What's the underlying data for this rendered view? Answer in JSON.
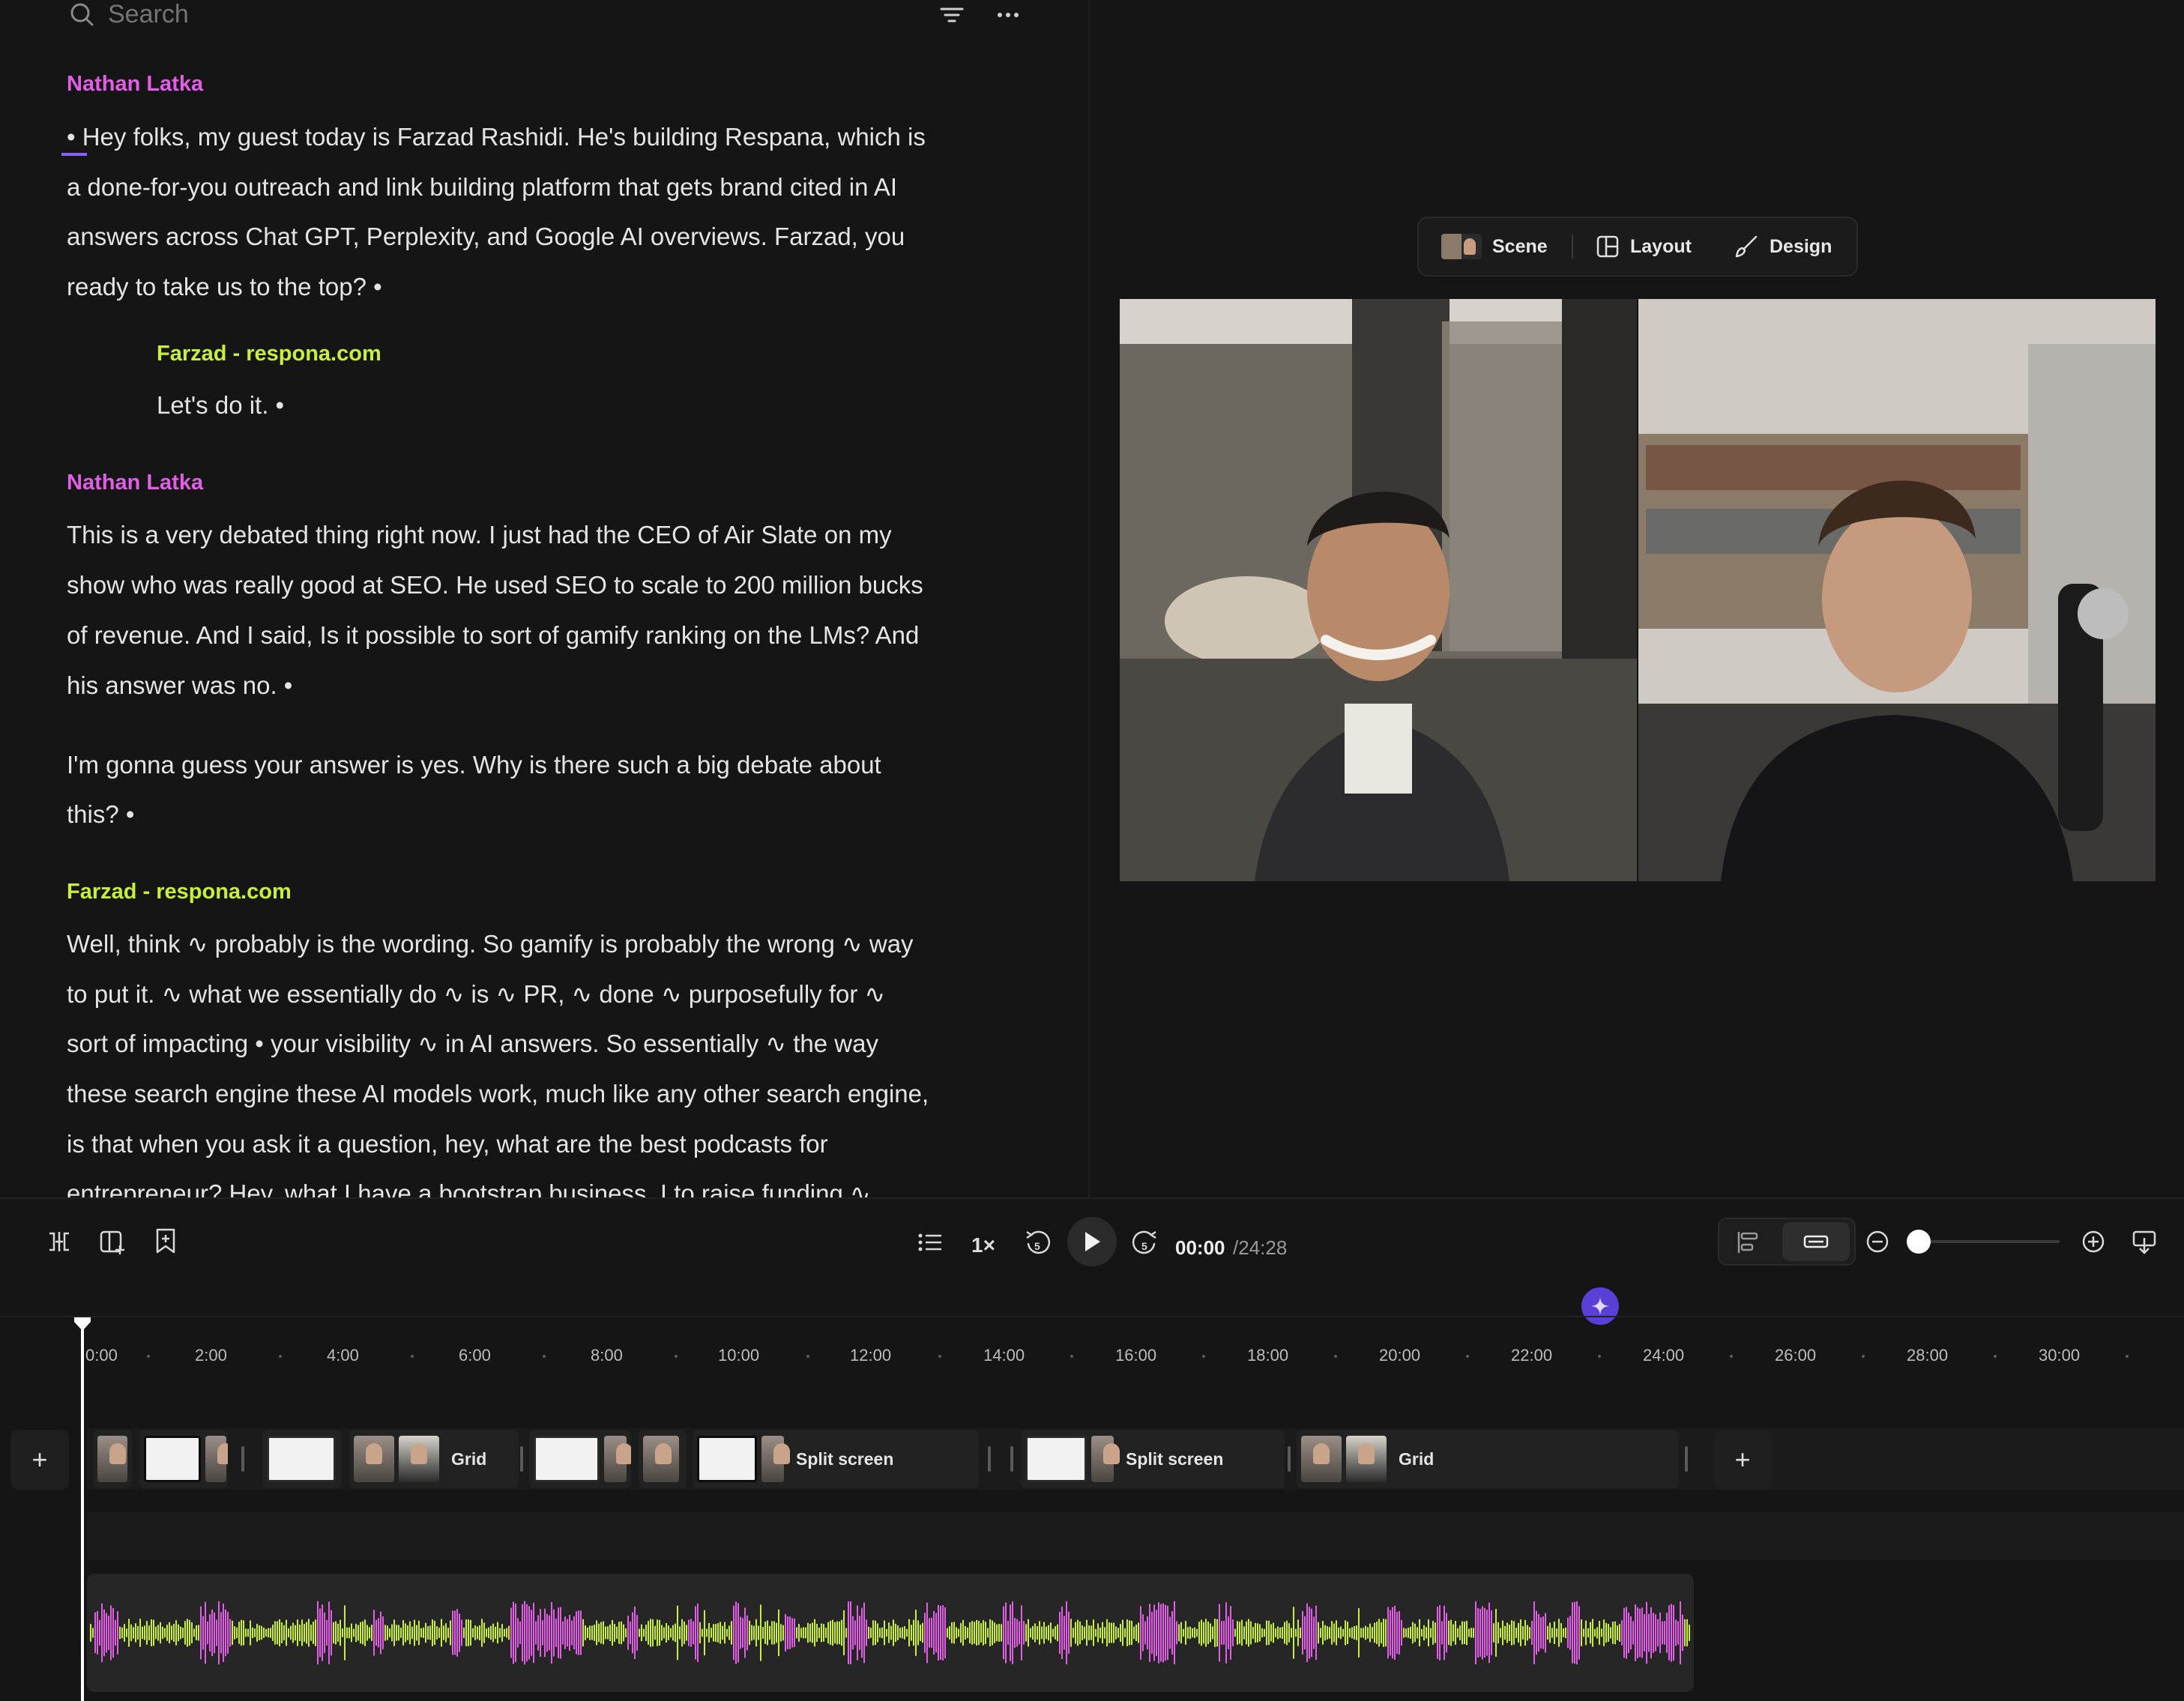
{
  "search": {
    "placeholder": "Search"
  },
  "transcript": {
    "speakers": {
      "nathan": "Nathan Latka",
      "farzad": "Farzad - respona.com"
    },
    "blocks": [
      {
        "speaker": "Nathan Latka",
        "lines": [
          "• Hey folks, my guest today is Farzad Rashidi. He's building Respana, which is",
          "a done-for-you outreach and link building platform that gets brand cited in AI",
          "answers across Chat GPT, Perplexity, and Google AI overviews. Farzad, you",
          "ready to take us to the top? •"
        ]
      },
      {
        "speaker": "Farzad - respona.com",
        "lines": [
          "Let's do it. •"
        ]
      },
      {
        "speaker": "Nathan Latka",
        "lines": [
          "This is a very debated thing right now. I just had the CEO of Air Slate on my",
          "show who was really good at SEO. He used SEO to scale to 200 million bucks",
          "of revenue. And I said, Is it possible to sort of gamify ranking on the LMs? And",
          "his answer was no. •"
        ]
      },
      {
        "speaker": "",
        "lines": [
          "I'm gonna guess your answer is yes. Why is there such a big debate about",
          "this? •"
        ]
      },
      {
        "speaker": "Farzad - respona.com",
        "lines": [
          "Well, think ∿ probably is the wording. So gamify is probably the wrong ∿ way",
          "to put it. ∿ what we essentially do ∿ is ∿ PR, ∿ done ∿ purposefully for ∿",
          "sort of impacting • your visibility ∿ in AI answers. So essentially ∿ the way",
          "these search engine these AI models work, much like any other search engine,",
          "is that when you ask it a question, hey, what are the best podcasts for",
          "entrepreneur? Hey, what I have a bootstrap business, I to raise funding ∿"
        ]
      }
    ]
  },
  "preview_toolbar": {
    "scene": "Scene",
    "layout": "Layout",
    "design": "Design"
  },
  "player": {
    "speed": "1×",
    "current_time": "00:00",
    "total_time": "/24:28",
    "zoom_level": 0.0
  },
  "timeline": {
    "ticks": [
      "0:00",
      "2:00",
      "4:00",
      "6:00",
      "8:00",
      "10:00",
      "12:00",
      "14:00",
      "16:00",
      "18:00",
      "20:00",
      "22:00",
      "24:00",
      "26:00",
      "28:00",
      "30:00"
    ],
    "clips": [
      {
        "label": ""
      },
      {
        "label": ""
      },
      {
        "label": ""
      },
      {
        "label": "Grid"
      },
      {
        "label": ""
      },
      {
        "label": ""
      },
      {
        "label": "Split screen"
      },
      {
        "label": "Split screen"
      },
      {
        "label": "Grid"
      }
    ]
  },
  "colors": {
    "speaker_nathan": "#e25ee6",
    "speaker_farzad": "#c8ef3a",
    "waveform_green": "#c8ef3a",
    "waveform_pink": "#e25ee6",
    "ai_accent": "#5b3fd6"
  }
}
